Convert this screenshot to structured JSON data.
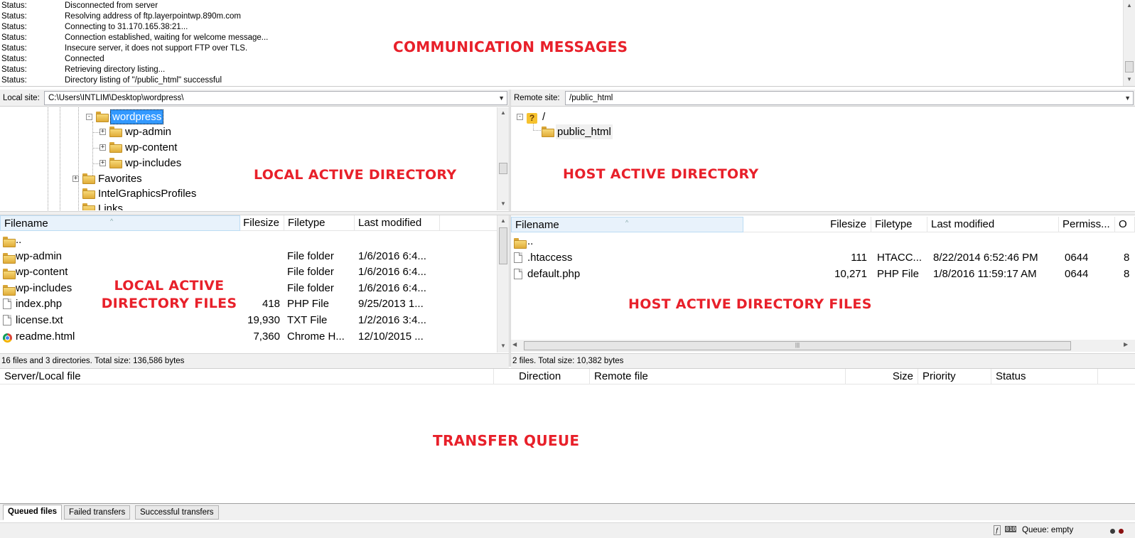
{
  "log": {
    "rows": [
      {
        "label": "Status:",
        "message": "Disconnected from server"
      },
      {
        "label": "Status:",
        "message": "Resolving address of ftp.layerpointwp.890m.com"
      },
      {
        "label": "Status:",
        "message": "Connecting to 31.170.165.38:21..."
      },
      {
        "label": "Status:",
        "message": "Connection established, waiting for welcome message..."
      },
      {
        "label": "Status:",
        "message": "Insecure server, it does not support FTP over TLS."
      },
      {
        "label": "Status:",
        "message": "Connected"
      },
      {
        "label": "Status:",
        "message": "Retrieving directory listing..."
      },
      {
        "label": "Status:",
        "message": "Directory listing of \"/public_html\" successful"
      }
    ]
  },
  "annotations": {
    "communication": "COMMUNICATION MESSAGES",
    "local_dir": "LOCAL ACTIVE DIRECTORY",
    "host_dir": "HOST ACTIVE DIRECTORY",
    "local_files_1": "LOCAL ACTIVE",
    "local_files_2": "DIRECTORY FILES",
    "host_files": "HOST ACTIVE DIRECTORY FILES",
    "queue": "TRANSFER QUEUE"
  },
  "local": {
    "site_label": "Local site:",
    "path": "C:\\Users\\INTLIM\\Desktop\\wordpress\\",
    "tree": [
      {
        "label": "wordpress",
        "expand": "-",
        "selected": true
      },
      {
        "label": "wp-admin",
        "expand": "+"
      },
      {
        "label": "wp-content",
        "expand": "+"
      },
      {
        "label": "wp-includes",
        "expand": "+"
      },
      {
        "label": "Favorites",
        "expand": "+"
      },
      {
        "label": "IntelGraphicsProfiles",
        "expand": ""
      },
      {
        "label": "Links",
        "expand": ""
      }
    ],
    "columns": {
      "filename": "Filename",
      "filesize": "Filesize",
      "filetype": "Filetype",
      "modified": "Last modified"
    },
    "files": [
      {
        "icon": "folder",
        "name": "..",
        "size": "",
        "type": "",
        "modified": ""
      },
      {
        "icon": "folder",
        "name": "wp-admin",
        "size": "",
        "type": "File folder",
        "modified": "1/6/2016 6:4..."
      },
      {
        "icon": "folder",
        "name": "wp-content",
        "size": "",
        "type": "File folder",
        "modified": "1/6/2016 6:4..."
      },
      {
        "icon": "folder",
        "name": "wp-includes",
        "size": "",
        "type": "File folder",
        "modified": "1/6/2016 6:4..."
      },
      {
        "icon": "file",
        "name": "index.php",
        "size": "418",
        "type": "PHP File",
        "modified": "9/25/2013 1..."
      },
      {
        "icon": "file",
        "name": "license.txt",
        "size": "19,930",
        "type": "TXT File",
        "modified": "1/2/2016 3:4..."
      },
      {
        "icon": "chrome",
        "name": "readme.html",
        "size": "7,360",
        "type": "Chrome H...",
        "modified": "12/10/2015 ..."
      }
    ],
    "summary": "16 files and 3 directories. Total size: 136,586 bytes"
  },
  "remote": {
    "site_label": "Remote site:",
    "path": "/public_html",
    "tree": [
      {
        "label": "/",
        "expand": "-"
      },
      {
        "label": "public_html",
        "expand": ""
      }
    ],
    "columns": {
      "filename": "Filename",
      "filesize": "Filesize",
      "filetype": "Filetype",
      "modified": "Last modified",
      "permissions": "Permiss...",
      "owner": "O"
    },
    "files": [
      {
        "icon": "folder",
        "name": "..",
        "size": "",
        "type": "",
        "modified": "",
        "perm": "",
        "owner": ""
      },
      {
        "icon": "file",
        "name": ".htaccess",
        "size": "111",
        "type": "HTACC...",
        "modified": "8/22/2014 6:52:46 PM",
        "perm": "0644",
        "owner": "8"
      },
      {
        "icon": "file",
        "name": "default.php",
        "size": "10,271",
        "type": "PHP File",
        "modified": "1/8/2016 11:59:17 AM",
        "perm": "0644",
        "owner": "8"
      }
    ],
    "summary": "2 files. Total size: 10,382 bytes"
  },
  "queue": {
    "columns": {
      "server_local": "Server/Local file",
      "direction": "Direction",
      "remote": "Remote file",
      "size": "Size",
      "priority": "Priority",
      "status": "Status"
    },
    "tabs": [
      "Queued files",
      "Failed transfers",
      "Successful transfers"
    ]
  },
  "statusbar": {
    "queue": "Queue: empty"
  },
  "colors": {
    "annotation": "#e8202a",
    "selection": "#3399ff"
  }
}
